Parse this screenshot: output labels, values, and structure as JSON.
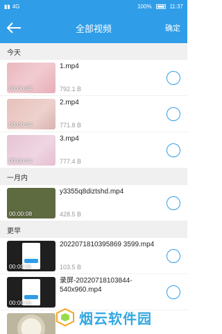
{
  "status": {
    "carrier": "4G",
    "battery": "100%",
    "time": "11:37"
  },
  "header": {
    "title": "全部视频",
    "confirm": "确定"
  },
  "sections": [
    {
      "label": "今天",
      "items": [
        {
          "name": "1.mp4",
          "size": "792.1 B",
          "duration": "00:00:04"
        },
        {
          "name": "2.mp4",
          "size": "771.8 B",
          "duration": "00:00:04"
        },
        {
          "name": "3.mp4",
          "size": "777.4 B",
          "duration": "00:00:04"
        }
      ]
    },
    {
      "label": "一月内",
      "items": [
        {
          "name": "y3355q8diztshd.mp4",
          "size": "428.5 B",
          "duration": "00:00:08"
        }
      ]
    },
    {
      "label": "更早",
      "items": [
        {
          "name": "2022071810395869 3599.mp4",
          "size": "103.5 B",
          "duration": "00:00:11"
        },
        {
          "name": "录屏-20220718103844-540x960.mp4",
          "size": "",
          "duration": "00:00:11"
        },
        {
          "name": "",
          "size": "",
          "duration": ""
        }
      ]
    }
  ],
  "watermark": {
    "text": "烟云软件园"
  },
  "colors": {
    "primary": "#2f9de8"
  },
  "icons": {
    "back": "back-arrow-icon",
    "radio": "radio-unchecked-icon"
  }
}
